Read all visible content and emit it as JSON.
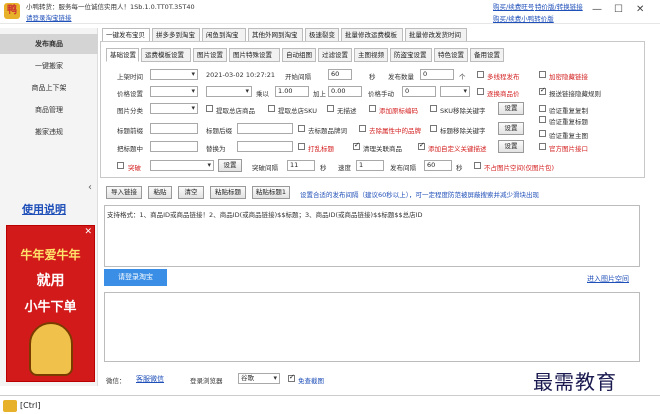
{
  "titlebar": {
    "app_name": "小鸭转货：服务每一位诚信实用人！1Sb.1.0.TT0T.35T40",
    "recharge_link": "请登录淘宝链接",
    "right_links": [
      "购买/续费旺号",
      "特价版/转换链接"
    ],
    "right_links2": [
      "购买/续费小鸭转价版"
    ],
    "window_controls": [
      "—",
      "☐",
      "✕"
    ]
  },
  "sidebar": {
    "items": [
      {
        "label": "发布商品",
        "active": true
      },
      {
        "label": "一键搬家"
      },
      {
        "label": "商品上下架"
      },
      {
        "label": "商品管理"
      },
      {
        "label": "搬家违规"
      }
    ],
    "collapse_arrow": "‹",
    "help_link": "使用说明"
  },
  "ad": {
    "line1": "牛年爱牛年",
    "line2": "就用",
    "line3": "小牛下单",
    "close": "✕"
  },
  "top_tabs": [
    "一键发布宝贝",
    "拼多多到淘宝",
    "闲鱼到淘宝",
    "其他外网到淘宝",
    "极速裂变",
    "批量修改运费模板",
    "批量修改发货时间"
  ],
  "sub_tabs": [
    "基础设置",
    "运费模板设置",
    "图片设置",
    "图片特殊设置",
    "自动组图",
    "过滤设置",
    "主图视频",
    "防盗宝设置",
    "特色设置",
    "备用设置"
  ],
  "form": {
    "row1": {
      "schedule_label": "上架时间",
      "schedule_value": "",
      "date_value": "2021-03-02 10:27:21",
      "interval_label": "开始间隔",
      "interval_value": "60",
      "interval_unit": "秒",
      "count_label": "发布数量",
      "count_value": "0",
      "count_unit": "个",
      "opt1": "多线程发布",
      "opt2": "加密隐藏链接"
    },
    "row2": {
      "price_label": "价格设置",
      "multiply_label": "乘以",
      "multiply_value": "1.00",
      "add_label": "加上",
      "add_value": "0.00",
      "manual_label": "价格手动",
      "manual_value": "0",
      "opt1": "逐换商品价",
      "opt2": "报送链接隐藏规则"
    },
    "row3": {
      "category_label": "图片分类",
      "opt_a": "提取总店商品",
      "opt_b": "提取总店SKU",
      "opt_c": "无描述",
      "opt_d": "添加原标编码",
      "opt_e": "SKU移除关键字",
      "settings_btn": "设置",
      "opt_f": "验证重复复制"
    },
    "row4": {
      "prefix_label": "标题前缀",
      "suffix_label": "标题后缀",
      "opt_a": "去标题品牌词",
      "opt_b": "去除属性中的品牌",
      "opt_c": "标题移除关键字",
      "settings_btn": "设置",
      "opt_d": "验证重复标题"
    },
    "row5": {
      "replace_label": "把标题中",
      "with_label": "替换为",
      "opt_a": "打乱标题",
      "opt_b": "清理关联商品",
      "opt_c": "添加自定义关键描述",
      "settings_btn": "设置",
      "opt_d": "验证重复主图",
      "opt_e": "官方图片接口"
    },
    "row6": {
      "opt_a": "突破",
      "settings_btn": "设置",
      "interval_label": "突破间隔",
      "interval_value": "11",
      "interval_unit": "秒",
      "speed_label": "速度",
      "speed_value": "1",
      "publish_interval_label": "发布间隔",
      "publish_interval_value": "60",
      "publish_unit": "秒",
      "opt_b": "不占图片空间(仅图片包)"
    }
  },
  "actions": {
    "import_btn": "导入链接",
    "paste_btn": "粘贴",
    "clear_btn": "清空",
    "paste_title_btn": "粘贴标题",
    "paste_title1_btn": "粘贴标题1",
    "hint": "设置合适的发布间隔（建议60秒以上），可一定程度防范被屏蔽搜索并减少滑块出现"
  },
  "links_area": {
    "text": "支持格式：1、商品ID或商品链接！2、商品ID(或商品链接)$$标题；3、商品ID(或商品链接)$$标题$$总店ID"
  },
  "login_btn": "请登录淘宝",
  "image_space_link": "进入图片空间",
  "status": {
    "wechat_label": "微信：",
    "wechat_link": "客服微信",
    "browser_label": "登录浏览器",
    "browser_value": "谷歌",
    "exempt_label": "免查截图"
  },
  "footer": {
    "tab_label": "[Ctrl]"
  },
  "watermark": "最需教育",
  "colors": {
    "accent": "#3a8ee6",
    "link": "#1f4fb8",
    "warn": "#d42020",
    "ad_bg": "#d31a1a"
  }
}
